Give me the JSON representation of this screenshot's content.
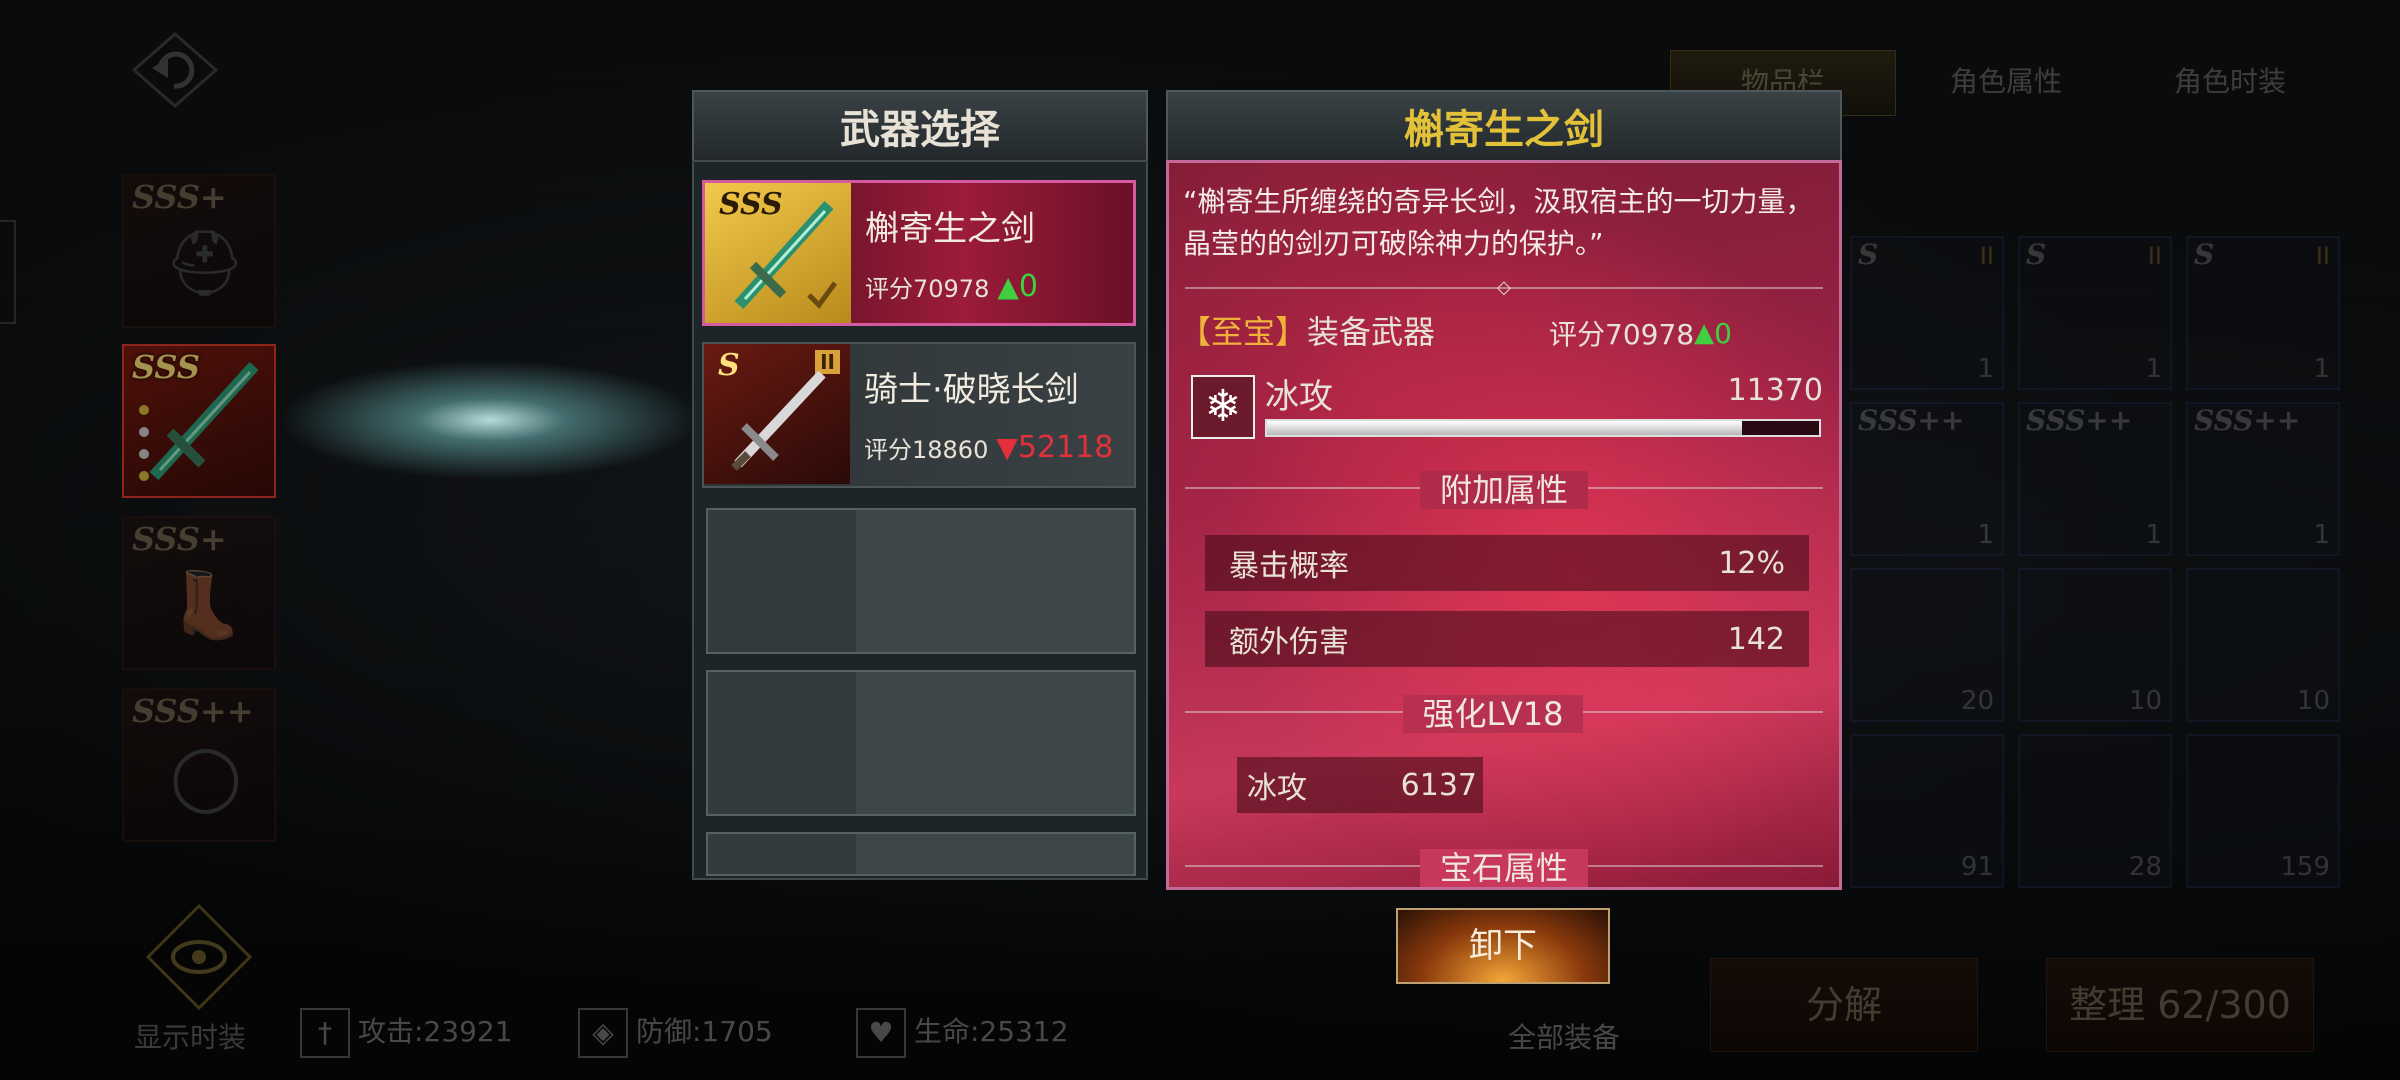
{
  "panel_title": "武器选择",
  "weapons": [
    {
      "grade": "SSS",
      "name": "槲寄生之剑",
      "score_label": "评分70978",
      "delta": "0"
    },
    {
      "grade": "S",
      "level": "II",
      "name": "骑士·破晓长剑",
      "score_label": "评分18860",
      "delta": "52118"
    }
  ],
  "detail": {
    "title": "槲寄生之剑",
    "description": "“槲寄生所缠绕的奇异长剑，汲取宿主的一切力量，晶莹的的剑刃可破除神力的保护。”",
    "tag": "【至宝】",
    "equip_type": "装备武器",
    "score_label": "评分70978",
    "score_delta": "0",
    "main_stat": {
      "name": "冰攻",
      "value": "11370",
      "fill_fraction": 0.86
    },
    "extra_title": "附加属性",
    "extra": [
      {
        "name": "暴击概率",
        "value": "12%"
      },
      {
        "name": "额外伤害",
        "value": "142"
      }
    ],
    "enhance_title": "强化LV18",
    "enhance_stat": {
      "name": "冰攻",
      "value": "6137"
    },
    "gem_title": "宝石属性"
  },
  "unequip_label": "卸下",
  "bg": {
    "tabs": [
      "物品栏",
      "角色属性",
      "角色时装"
    ],
    "left_grades": [
      "SSS+",
      "SSS",
      "SSS+",
      "SSS++"
    ],
    "show_fashion": "显示时装",
    "attack": "攻击:23921",
    "defense": "防御:1705",
    "life": "生命:25312",
    "all_equip": "全部装备",
    "decompose": "分解",
    "organize": "整理 62/300",
    "inventory_grades": [
      "S",
      "S",
      "S",
      "SSS++",
      "SSS++",
      "SSS++"
    ],
    "inventory_levels": [
      "II",
      "II",
      "II"
    ],
    "inventory_counts": [
      "1",
      "1",
      "1",
      "1",
      "1",
      "1",
      "20",
      "10",
      "10",
      "91",
      "28",
      "159"
    ]
  },
  "colors": {
    "gold": "#d4b83c",
    "green": "#3fcf3f",
    "red": "#e3303a",
    "tag": "#f0b23a"
  }
}
